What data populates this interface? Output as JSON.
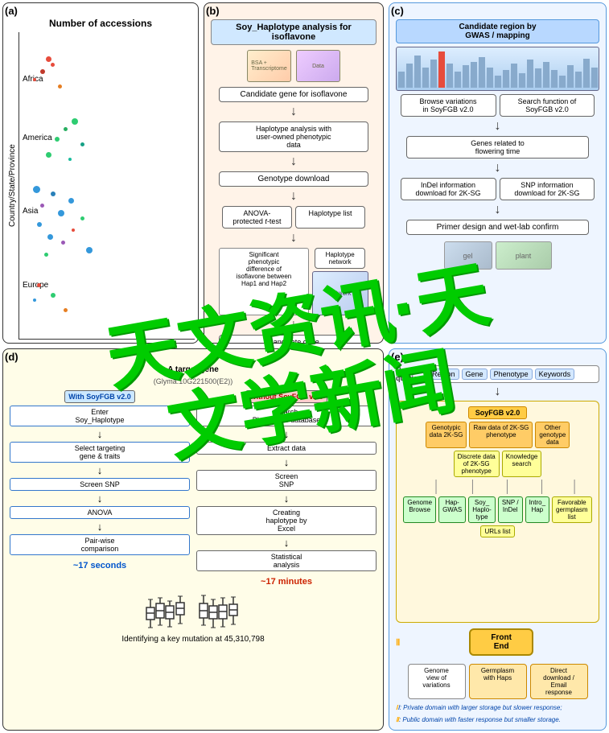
{
  "panels": {
    "a": {
      "label": "(a)",
      "title": "Number of accessions",
      "y_axis": "Country/State/Province",
      "regions": [
        "Africa",
        "America",
        "Asia",
        "Europe"
      ],
      "region_positions": [
        "14%",
        "35%",
        "60%",
        "85%"
      ]
    },
    "b": {
      "label": "(b)",
      "title": "Soy_Haplotype analysis for isoflavone",
      "bsa_label": "BSA + Transcriptome",
      "candidate_gene": "Candidate gene for isoflavone",
      "haplotype_analysis": "Haplotype analysis with\nuser-owned phenotypic data",
      "genotype_download": "Genotype download",
      "anova": "ANOVA-\nprotected t-test",
      "haplotype_list": "Haplotype list",
      "sig_phenotype": "Significant\nphenotypic\ndifference of\nisoflavone between\nHap1 and Hap2",
      "haplotype_network": "Haplotype network",
      "candidate_transmission": "Candidate gene\ntransmission/\nmedia"
    },
    "c": {
      "label": "(c)",
      "title": "Candidate region by\nGWAS / mapping",
      "browse_variations": "Browse variations\nin SoyFGB v2.0",
      "search_function": "Search function of\nSoyFGB v2.0",
      "genes_flowering": "Genes related to\nflowering time",
      "indel_info": "InDel information\ndownload for 2K-SG",
      "snp_info": "SNP information\ndownload for 2K-SG",
      "primer_design": "Primer design and wet-lab confirm"
    },
    "d": {
      "label": "(d)",
      "title": "A target gene",
      "subtitle": "(Glyma.10G221500(E2))",
      "with_label": "With SoyFGB v2.0",
      "without_label": "Without SoyFGB v2.0",
      "col1": {
        "step1": "Enter\nSoy_Haplotype",
        "step2": "Select targeting\ngene & traits",
        "step3": "Screen SNP",
        "step4": "ANOVA",
        "step5": "Pair-wise\ncomparison",
        "time": "~17 seconds"
      },
      "col2": {
        "step1": "Search\nPhytozome database",
        "step2": "Extract data",
        "step3": "Screen\nSNP",
        "step4": "Creating\nhaplotype by\nExcel",
        "step5": "Statistical\nanalysis",
        "time": "~17 minutes"
      },
      "bottom": "Identifying a key mutation\nat 45,310,798"
    },
    "e": {
      "label": "(e)",
      "title": "SoyFGB v2.0",
      "queries_label": "User\nqueries",
      "query_items": [
        "Region",
        "Gene",
        "Phenotype",
        "Keywords"
      ],
      "private_domain": "SoyFGB v2.0",
      "network_nodes_top": [
        "Genotypic\ndata 2K-SG",
        "Raw data of 2K-SG\nphenotype",
        "Other\ngenotype\ndata",
        "Discrete data\nof 2K-SG\nphenotype",
        "Knowledge\nsearch"
      ],
      "network_nodes_bottom": [
        "Genome\nBrowse",
        "Hap-\nGWAS",
        "Soy_\nHaplo-\ntype",
        "SNP /\nInDel",
        "Intro_\nHap",
        "Favorable\ngermplasm\nlist",
        "URLs list"
      ],
      "roman_I": "Ⅰ",
      "roman_II": "Ⅱ",
      "frontend": "Front\nEnd",
      "outputs": [
        "Genome\nview of\nvariations",
        "Germplasm\nwith Haps",
        "Direct\ndownload /\nEmail\nresponse"
      ],
      "note_I": "Ⅰ: Private domain with larger storage but slower response;",
      "note_II": "Ⅱ: Public domain with faster response but smaller storage."
    }
  },
  "watermark": {
    "line1": "天文资讯·天",
    "line2": "文学新闻"
  }
}
